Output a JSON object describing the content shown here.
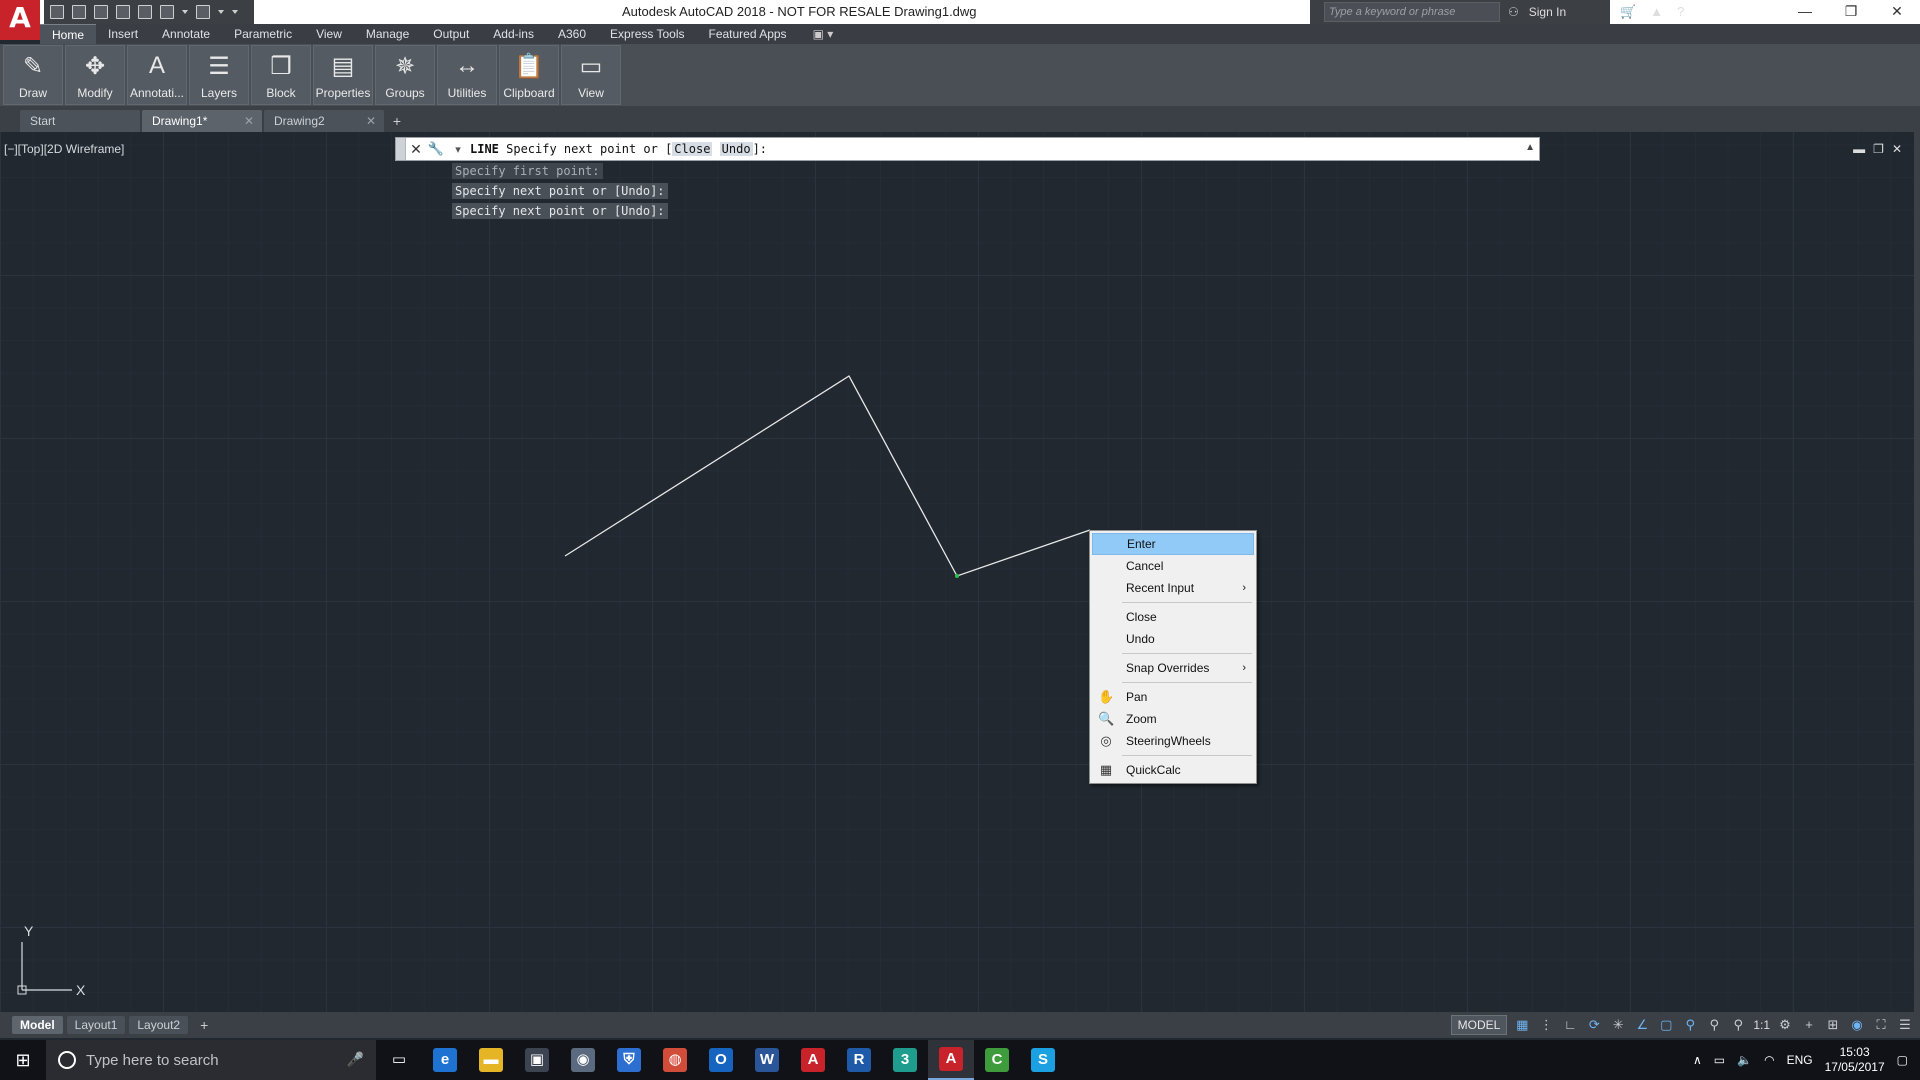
{
  "titlebar": {
    "logo": "A",
    "title": "Autodesk AutoCAD 2018 - NOT FOR RESALE    Drawing1.dwg",
    "search_placeholder": "Type a keyword or phrase",
    "sign_in": "Sign In",
    "min": "—",
    "restore": "❐",
    "close": "✕"
  },
  "ribbon_tabs": [
    "Home",
    "Insert",
    "Annotate",
    "Parametric",
    "View",
    "Manage",
    "Output",
    "Add-ins",
    "A360",
    "Express Tools",
    "Featured Apps"
  ],
  "ribbon_panels": [
    {
      "label": "Draw",
      "icon": "pencil-icon",
      "glyph": "✎"
    },
    {
      "label": "Modify",
      "icon": "move-icon",
      "glyph": "✥"
    },
    {
      "label": "Annotati...",
      "icon": "text-icon",
      "glyph": "A"
    },
    {
      "label": "Layers",
      "icon": "layers-icon",
      "glyph": "☰"
    },
    {
      "label": "Block",
      "icon": "block-icon",
      "glyph": "❒"
    },
    {
      "label": "Properties",
      "icon": "properties-icon",
      "glyph": "▤"
    },
    {
      "label": "Groups",
      "icon": "groups-icon",
      "glyph": "✵"
    },
    {
      "label": "Utilities",
      "icon": "utilities-icon",
      "glyph": "↔"
    },
    {
      "label": "Clipboard",
      "icon": "clipboard-icon",
      "glyph": "📋"
    },
    {
      "label": "View",
      "icon": "view-icon",
      "glyph": "▭"
    }
  ],
  "file_tabs": [
    {
      "label": "Start",
      "closable": false
    },
    {
      "label": "Drawing1*",
      "closable": true
    },
    {
      "label": "Drawing2",
      "closable": true
    }
  ],
  "viewport": {
    "label": "[−][Top][2D Wireframe]"
  },
  "command_line": {
    "keyword": "LINE",
    "prompt_before": " Specify next point or [",
    "option_close": "Close",
    "option_undo": "Undo",
    "prompt_after": "]:",
    "history": [
      "Specify first point:",
      "Specify next point or [Undo]:",
      "Specify next point or [Undo]:"
    ]
  },
  "context_menu": {
    "items": [
      {
        "label": "Enter",
        "highlight": true
      },
      {
        "label": "Cancel"
      },
      {
        "label": "Recent Input",
        "submenu": true
      },
      {
        "sep": true
      },
      {
        "label": "Close"
      },
      {
        "label": "Undo"
      },
      {
        "sep": true
      },
      {
        "label": "Snap Overrides",
        "submenu": true
      },
      {
        "sep": true
      },
      {
        "label": "Pan",
        "icon": "pan-icon",
        "glyph": "✋"
      },
      {
        "label": "Zoom",
        "icon": "zoom-icon",
        "glyph": "🔍"
      },
      {
        "label": "SteeringWheels",
        "icon": "steering-wheel-icon",
        "glyph": "◎"
      },
      {
        "sep": true
      },
      {
        "label": "QuickCalc",
        "icon": "calculator-icon",
        "glyph": "▦"
      }
    ]
  },
  "ucs": {
    "x_label": "X",
    "y_label": "Y"
  },
  "layout_tabs": [
    "Model",
    "Layout1",
    "Layout2"
  ],
  "status": {
    "model": "MODEL",
    "scale": "1:1"
  },
  "taskbar": {
    "search_placeholder": "Type here to search",
    "lang": "ENG",
    "time": "15:03",
    "date": "17/05/2017",
    "apps": [
      {
        "name": "task-view",
        "glyph": "▭",
        "color": "transparent"
      },
      {
        "name": "edge",
        "glyph": "e",
        "color": "#1e73d2"
      },
      {
        "name": "file-explorer",
        "glyph": "▬",
        "color": "#e6b526"
      },
      {
        "name": "store",
        "glyph": "▣",
        "color": "#3c4452"
      },
      {
        "name": "app-globe",
        "glyph": "◉",
        "color": "#5b6a7e"
      },
      {
        "name": "security",
        "glyph": "⛨",
        "color": "#2d6fd1"
      },
      {
        "name": "chrome",
        "glyph": "◍",
        "color": "#d24c3a"
      },
      {
        "name": "outlook",
        "glyph": "O",
        "color": "#1565c0"
      },
      {
        "name": "word",
        "glyph": "W",
        "color": "#2a5699"
      },
      {
        "name": "autocad",
        "glyph": "A",
        "color": "#c8222b"
      },
      {
        "name": "revit",
        "glyph": "R",
        "color": "#1f5aa8"
      },
      {
        "name": "3dsmax",
        "glyph": "3",
        "color": "#1e9c8e"
      },
      {
        "name": "autocad-active",
        "glyph": "A",
        "color": "#c8222b",
        "active": true
      },
      {
        "name": "camtasia",
        "glyph": "C",
        "color": "#3e9c3c"
      },
      {
        "name": "skype",
        "glyph": "S",
        "color": "#1ba1e2"
      }
    ]
  },
  "colors": {
    "canvas_bg": "#212830",
    "line": "#e8e8e8",
    "highlight": "#91c9f7"
  }
}
